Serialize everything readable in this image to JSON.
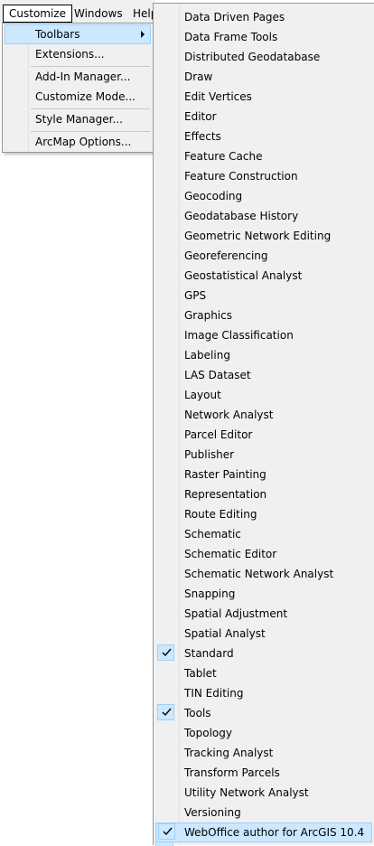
{
  "menubar": {
    "items": [
      {
        "label": "Customize"
      },
      {
        "label": "Windows"
      },
      {
        "label": "Help"
      }
    ]
  },
  "customize_menu": {
    "items": [
      {
        "label": "Toolbars",
        "has_submenu": true,
        "highlighted": true
      },
      {
        "label": "Extensions..."
      },
      {
        "label": "Add-In Manager..."
      },
      {
        "label": "Customize Mode..."
      },
      {
        "label": "Style Manager..."
      },
      {
        "label": "ArcMap Options..."
      }
    ]
  },
  "toolbars_submenu": {
    "items": [
      {
        "label": "Data Driven Pages",
        "checked": false
      },
      {
        "label": "Data Frame Tools",
        "checked": false
      },
      {
        "label": "Distributed Geodatabase",
        "checked": false
      },
      {
        "label": "Draw",
        "checked": false
      },
      {
        "label": "Edit Vertices",
        "checked": false
      },
      {
        "label": "Editor",
        "checked": false
      },
      {
        "label": "Effects",
        "checked": false
      },
      {
        "label": "Feature Cache",
        "checked": false
      },
      {
        "label": "Feature Construction",
        "checked": false
      },
      {
        "label": "Geocoding",
        "checked": false
      },
      {
        "label": "Geodatabase History",
        "checked": false
      },
      {
        "label": "Geometric Network Editing",
        "checked": false
      },
      {
        "label": "Georeferencing",
        "checked": false
      },
      {
        "label": "Geostatistical Analyst",
        "checked": false
      },
      {
        "label": "GPS",
        "checked": false
      },
      {
        "label": "Graphics",
        "checked": false
      },
      {
        "label": "Image Classification",
        "checked": false
      },
      {
        "label": "Labeling",
        "checked": false
      },
      {
        "label": "LAS Dataset",
        "checked": false
      },
      {
        "label": "Layout",
        "checked": false
      },
      {
        "label": "Network Analyst",
        "checked": false
      },
      {
        "label": "Parcel Editor",
        "checked": false
      },
      {
        "label": "Publisher",
        "checked": false
      },
      {
        "label": "Raster Painting",
        "checked": false
      },
      {
        "label": "Representation",
        "checked": false
      },
      {
        "label": "Route Editing",
        "checked": false
      },
      {
        "label": "Schematic",
        "checked": false
      },
      {
        "label": "Schematic Editor",
        "checked": false
      },
      {
        "label": "Schematic Network Analyst",
        "checked": false
      },
      {
        "label": "Snapping",
        "checked": false
      },
      {
        "label": "Spatial Adjustment",
        "checked": false
      },
      {
        "label": "Spatial Analyst",
        "checked": false
      },
      {
        "label": "Standard",
        "checked": true
      },
      {
        "label": "Tablet",
        "checked": false
      },
      {
        "label": "TIN Editing",
        "checked": false
      },
      {
        "label": "Tools",
        "checked": true
      },
      {
        "label": "Topology",
        "checked": false
      },
      {
        "label": "Tracking Analyst",
        "checked": false
      },
      {
        "label": "Transform Parcels",
        "checked": false
      },
      {
        "label": "Utility Network Analyst",
        "checked": false
      },
      {
        "label": "Versioning",
        "checked": false
      },
      {
        "label": "WebOffice author for ArcGIS 10.4",
        "checked": true,
        "highlighted": true
      }
    ]
  },
  "colors": {
    "menu_bg": "#f0f0f0",
    "highlight_bg": "#cce8ff",
    "highlight_border": "#99d1ff"
  }
}
